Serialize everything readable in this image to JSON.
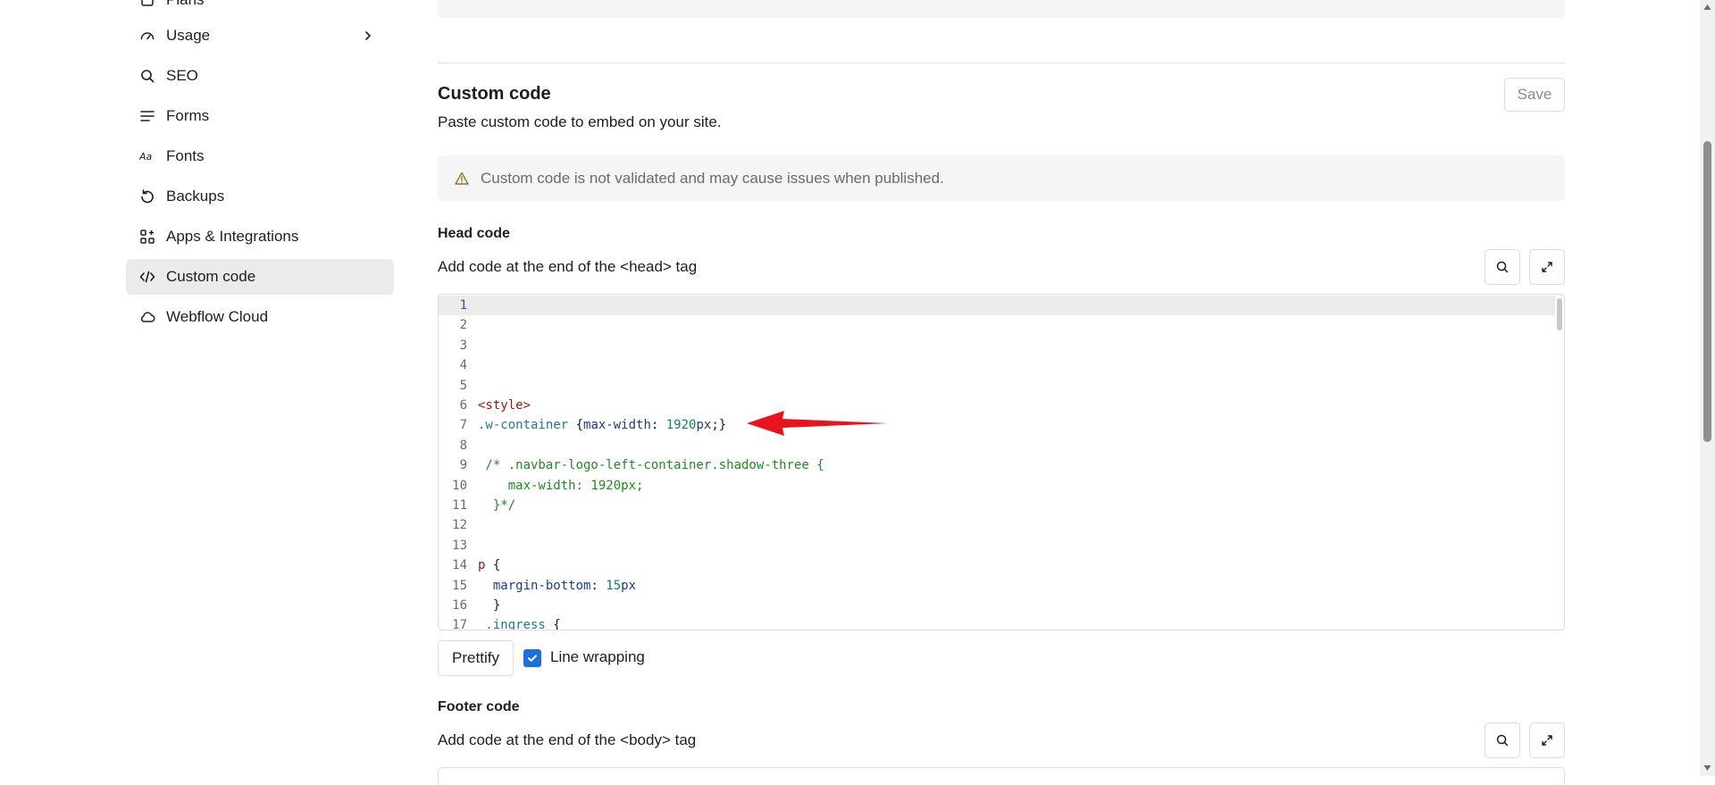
{
  "sidebar": {
    "items": [
      {
        "label": "Plans",
        "icon": "plans-icon"
      },
      {
        "label": "Usage",
        "icon": "gauge-icon"
      },
      {
        "label": "SEO",
        "icon": "search-icon"
      },
      {
        "label": "Forms",
        "icon": "form-lines-icon"
      },
      {
        "label": "Fonts",
        "icon": "font-aa-icon"
      },
      {
        "label": "Backups",
        "icon": "backup-restore-icon"
      },
      {
        "label": "Apps & Integrations",
        "icon": "apps-grid-icon"
      },
      {
        "label": "Custom code",
        "icon": "code-icon",
        "active": true
      },
      {
        "label": "Webflow Cloud",
        "icon": "cloud-icon"
      }
    ]
  },
  "main": {
    "section_title": "Custom code",
    "section_desc": "Paste custom code to embed on your site.",
    "save_label": "Save",
    "warning_text": "Custom code is not validated and may cause issues when published.",
    "head": {
      "title": "Head code",
      "desc": "Add code at the end of the <head> tag"
    },
    "footer": {
      "title": "Footer code",
      "desc": "Add code at the end of the <body> tag"
    },
    "prettify_label": "Prettify",
    "line_wrapping_label": "Line wrapping",
    "line_wrapping_checked": true
  },
  "editor": {
    "current_line": 1,
    "lines": [
      {
        "n": "1",
        "tokens": []
      },
      {
        "n": "2",
        "tokens": []
      },
      {
        "n": "3",
        "tokens": []
      },
      {
        "n": "4",
        "tokens": []
      },
      {
        "n": "5",
        "tokens": []
      },
      {
        "n": "6",
        "tokens": [
          {
            "t": "<style>",
            "c": "tag"
          }
        ]
      },
      {
        "n": "7",
        "tokens": [
          {
            "t": ".w-container",
            "c": "sel"
          },
          {
            "t": " {",
            "c": "plain"
          },
          {
            "t": "max-width",
            "c": "prop"
          },
          {
            "t": ": ",
            "c": "plain"
          },
          {
            "t": "1920",
            "c": "num"
          },
          {
            "t": "px",
            "c": "unit"
          },
          {
            "t": ";}",
            "c": "plain"
          }
        ]
      },
      {
        "n": "8",
        "tokens": []
      },
      {
        "n": "9",
        "tokens": [
          {
            "t": " /* .navbar-logo-left-container.shadow-three {",
            "c": "cmt"
          }
        ]
      },
      {
        "n": "10",
        "tokens": [
          {
            "t": "    max-width: 1920px;",
            "c": "cmt"
          }
        ]
      },
      {
        "n": "11",
        "tokens": [
          {
            "t": "  }*/",
            "c": "cmt"
          }
        ]
      },
      {
        "n": "12",
        "tokens": []
      },
      {
        "n": "13",
        "tokens": []
      },
      {
        "n": "14",
        "tokens": [
          {
            "t": "p",
            "c": "tag"
          },
          {
            "t": " {",
            "c": "plain"
          }
        ]
      },
      {
        "n": "15",
        "tokens": [
          {
            "t": "  margin-bottom",
            "c": "prop"
          },
          {
            "t": ": ",
            "c": "plain"
          },
          {
            "t": "15",
            "c": "num"
          },
          {
            "t": "px",
            "c": "unit"
          }
        ]
      },
      {
        "n": "16",
        "tokens": [
          {
            "t": "  }",
            "c": "plain"
          }
        ]
      },
      {
        "n": "17",
        "tokens": [
          {
            "t": " .ingress",
            "c": "sel"
          },
          {
            "t": " {",
            "c": "plain"
          }
        ]
      }
    ]
  },
  "colors": {
    "accent": "#1d6fe0",
    "annotation_arrow": "#e8141b",
    "active_nav_bg": "#ebebeb",
    "warning_bg": "#f5f5f5"
  }
}
